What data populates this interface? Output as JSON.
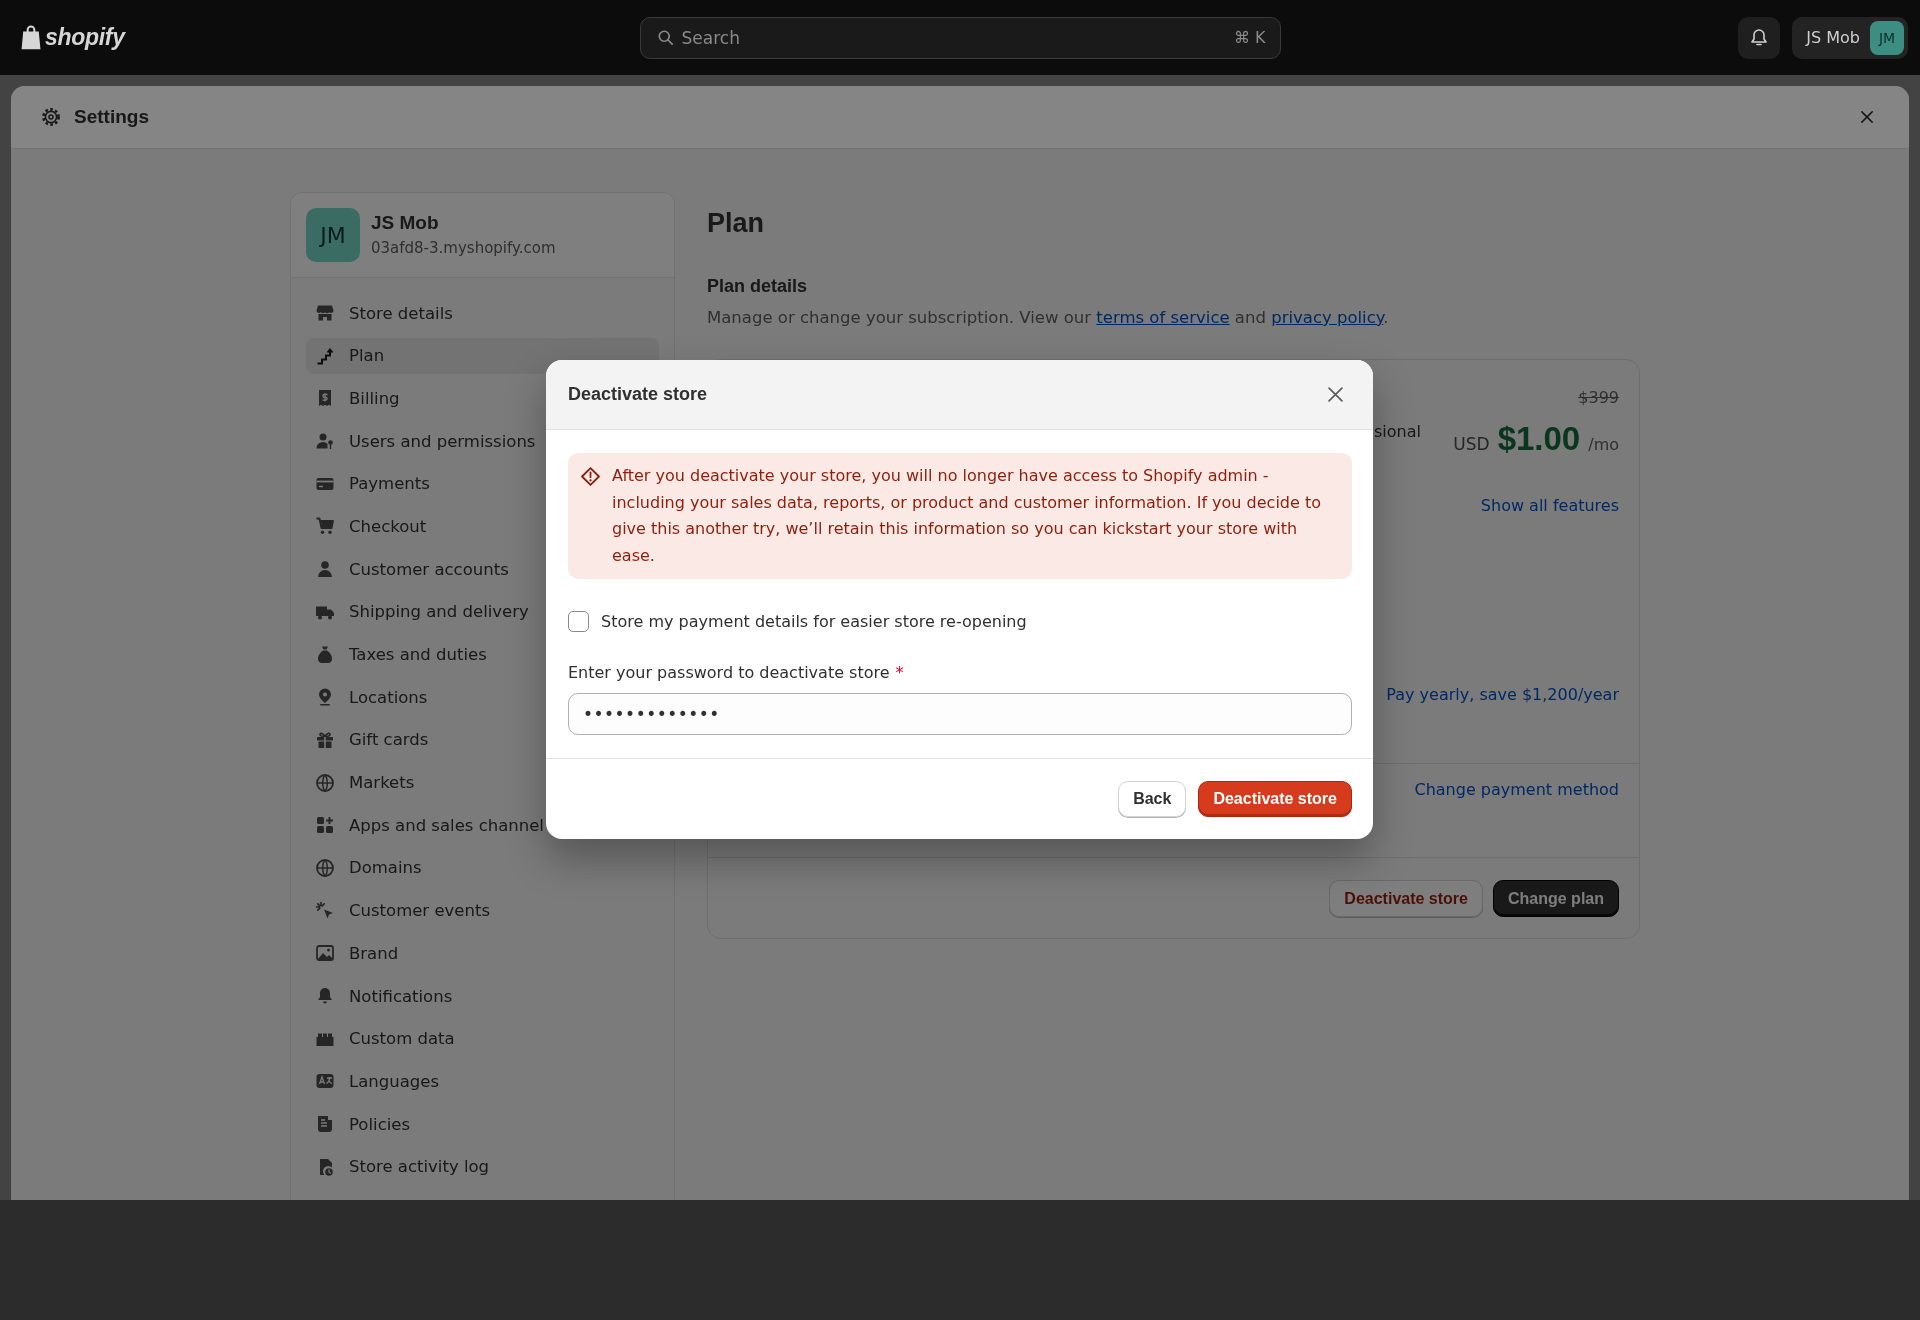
{
  "top_bar": {
    "logo_text": "shopify",
    "search": {
      "placeholder": "Search",
      "shortcut": "⌘ K"
    },
    "account": {
      "name": "JS Mob",
      "initials": "JM"
    }
  },
  "settings": {
    "title": "Settings",
    "sidebar": {
      "store": {
        "initials": "JM",
        "name": "JS Mob",
        "domain": "03afd8-3.myshopify.com"
      },
      "items": [
        {
          "label": "Store details",
          "selected": false
        },
        {
          "label": "Plan",
          "selected": true
        },
        {
          "label": "Billing",
          "selected": false
        },
        {
          "label": "Users and permissions",
          "selected": false
        },
        {
          "label": "Payments",
          "selected": false
        },
        {
          "label": "Checkout",
          "selected": false
        },
        {
          "label": "Customer accounts",
          "selected": false
        },
        {
          "label": "Shipping and delivery",
          "selected": false
        },
        {
          "label": "Taxes and duties",
          "selected": false
        },
        {
          "label": "Locations",
          "selected": false
        },
        {
          "label": "Gift cards",
          "selected": false
        },
        {
          "label": "Markets",
          "selected": false
        },
        {
          "label": "Apps and sales channel",
          "selected": false
        },
        {
          "label": "Domains",
          "selected": false
        },
        {
          "label": "Customer events",
          "selected": false
        },
        {
          "label": "Brand",
          "selected": false
        },
        {
          "label": "Notifications",
          "selected": false
        },
        {
          "label": "Custom data",
          "selected": false
        },
        {
          "label": "Languages",
          "selected": false
        },
        {
          "label": "Policies",
          "selected": false
        },
        {
          "label": "Store activity log",
          "selected": false
        }
      ]
    },
    "page": {
      "title": "Plan",
      "section_title": "Plan details",
      "description": [
        {
          "kind": "text",
          "text": "Manage or change your subscription. View our "
        },
        {
          "kind": "link",
          "text": "terms of service"
        },
        {
          "kind": "text",
          "text": " and "
        },
        {
          "kind": "link",
          "text": "privacy policy"
        },
        {
          "kind": "text",
          "text": "."
        }
      ],
      "plan_card": {
        "plan_name": "sional",
        "original_price": "$399",
        "currency": "USD",
        "price": "$1.00",
        "period": "/mo",
        "features_link": "Show all features",
        "yearly_link": "Pay yearly, save $1,200/year",
        "payment_link": "Change payment method",
        "buttons": [
          {
            "label": "Deactivate store",
            "kind": "critical"
          },
          {
            "label": "Change plan",
            "kind": "primary"
          }
        ]
      }
    }
  },
  "modal": {
    "title": "Deactivate store",
    "banner": {
      "text": "After you deactivate your store, you will no longer have access to Shopify admin - including your sales data, reports, or product and customer information. If you decide to give this another try, we’ll retain this information so you can kickstart your store with ease."
    },
    "checkbox": {
      "label": "Store my payment details for easier store re-opening",
      "checked": false
    },
    "password": {
      "label": "Enter your password to deactivate store",
      "required_mark": "*",
      "value": "•••••••••••••"
    },
    "buttons": [
      {
        "label": "Back",
        "kind": "secondary"
      },
      {
        "label": "Deactivate store",
        "kind": "destructive"
      }
    ]
  }
}
